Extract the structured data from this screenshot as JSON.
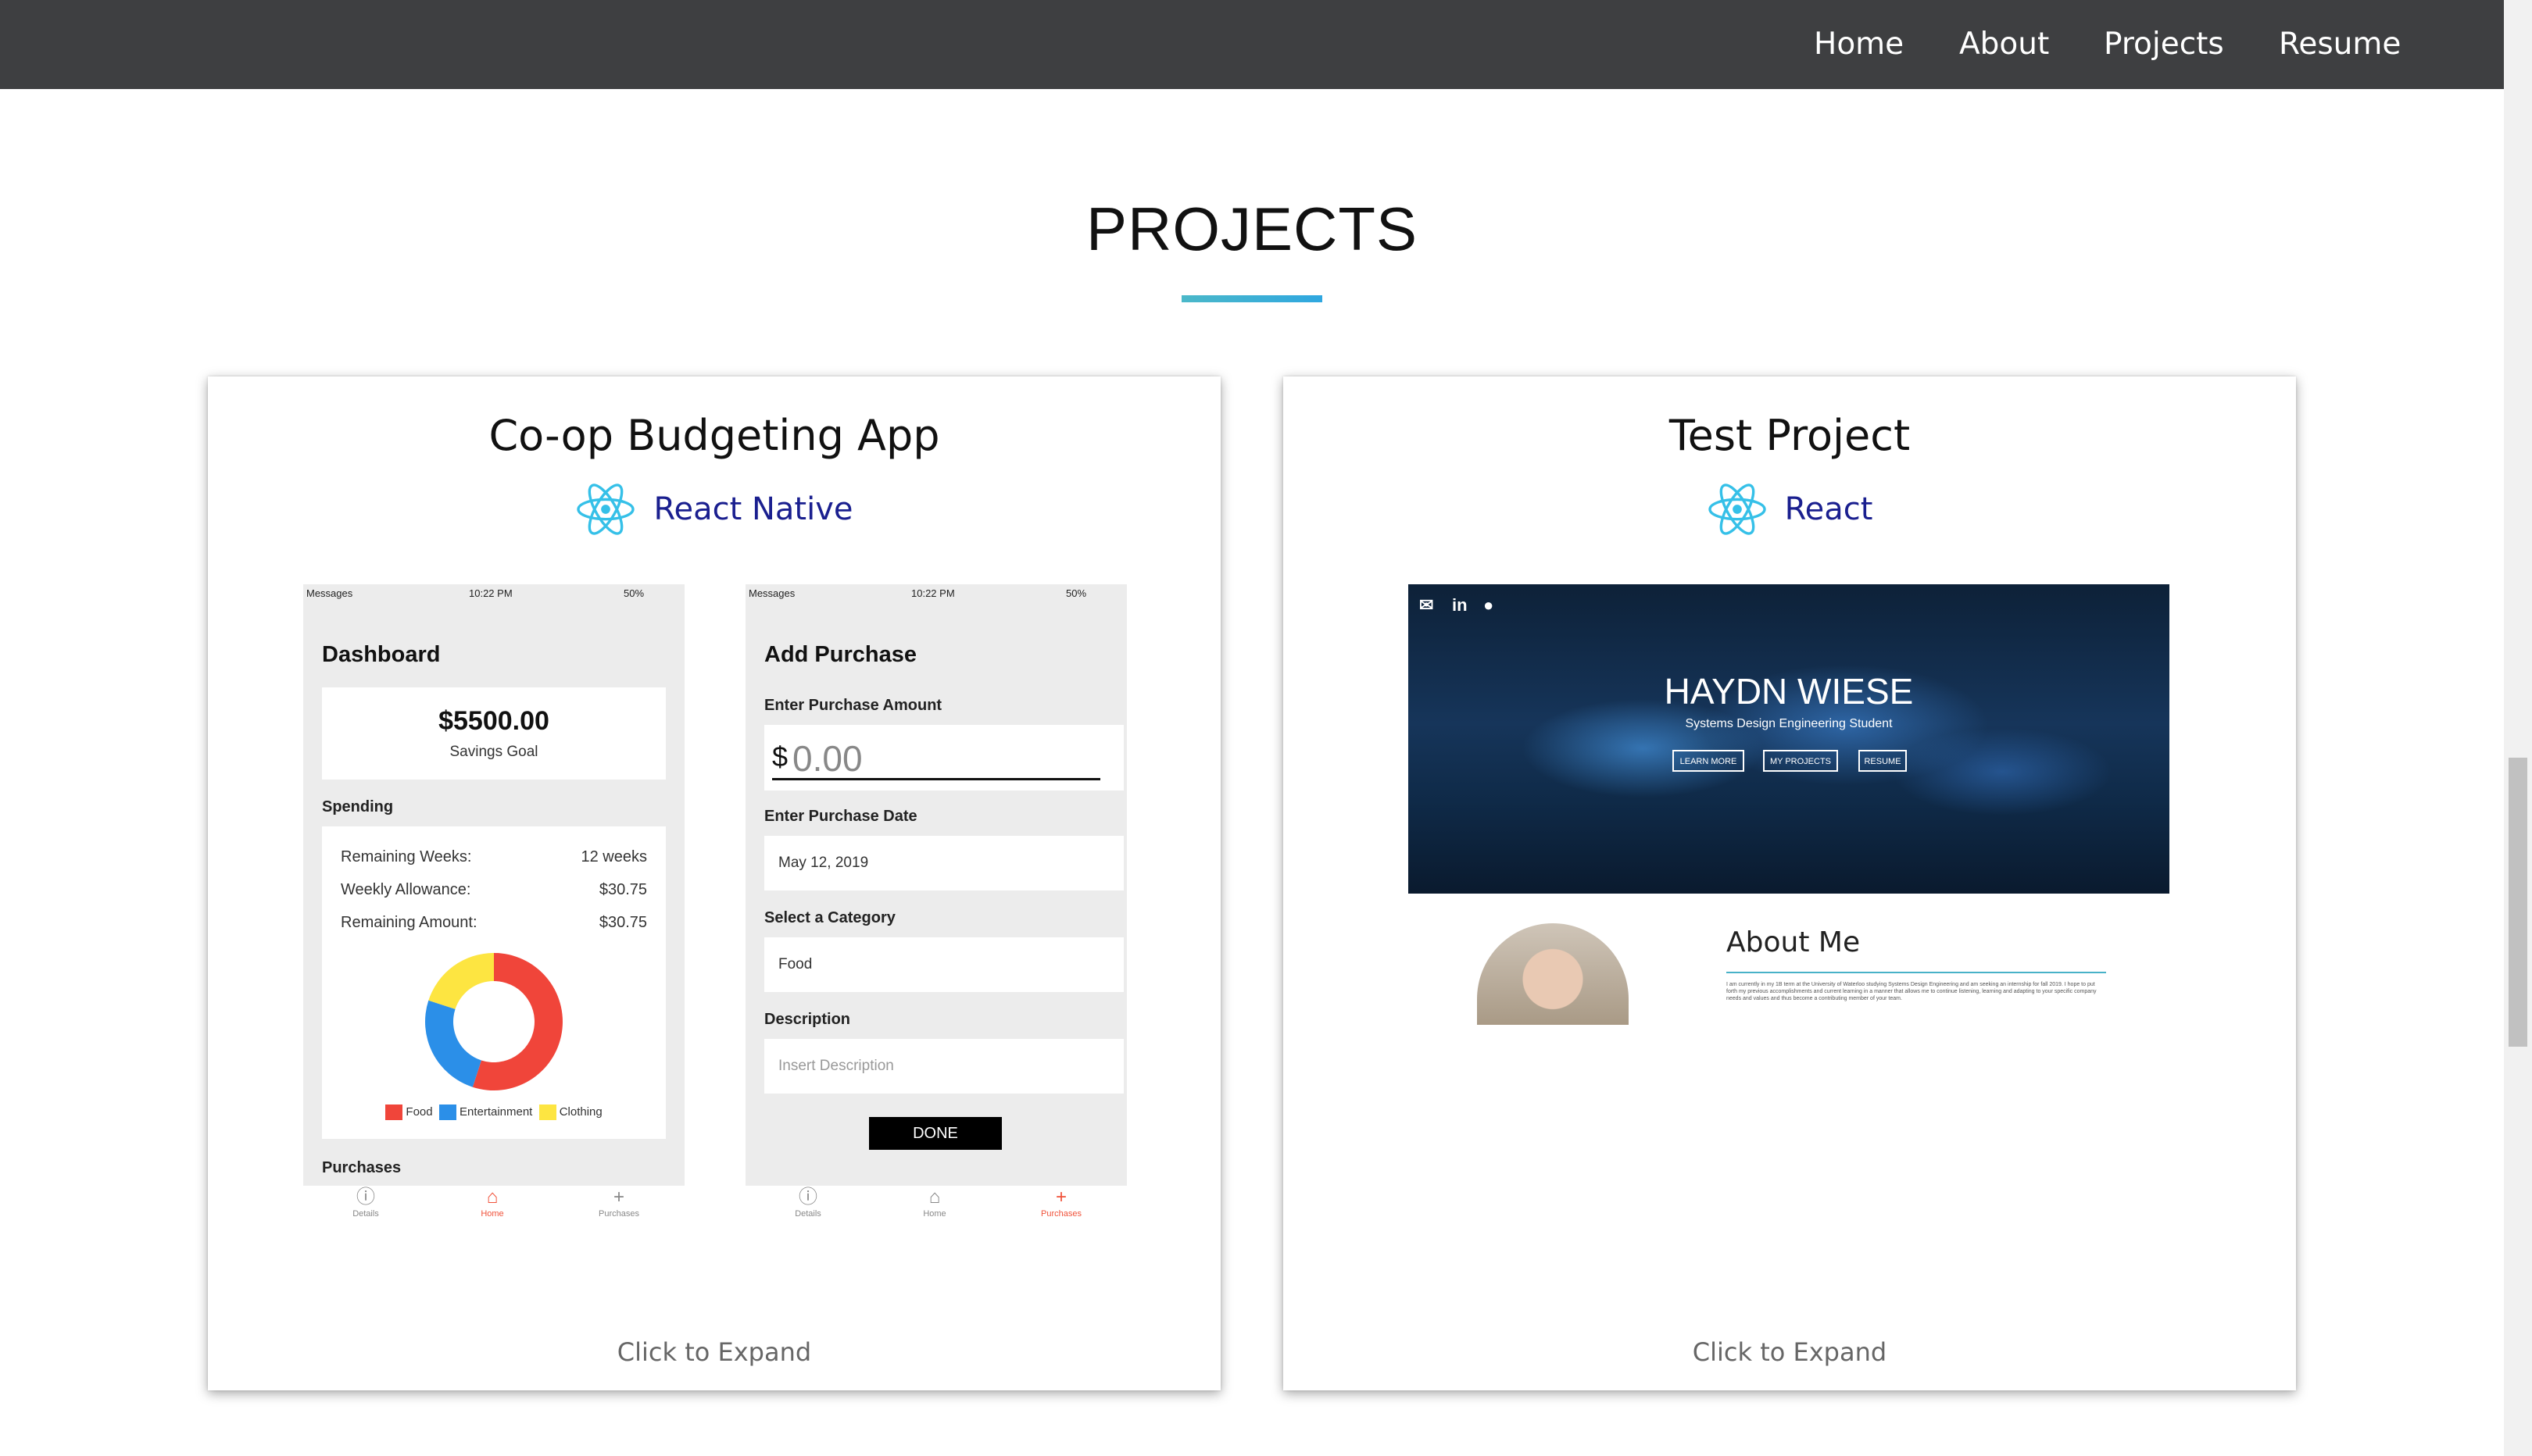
{
  "nav": {
    "links": [
      "Home",
      "About",
      "Projects",
      "Resume"
    ]
  },
  "section": {
    "title": "PROJECTS"
  },
  "projects": [
    {
      "title": "Co-op Budgeting App",
      "tech": "React Native",
      "expand": "Click to Expand"
    },
    {
      "title": "Test Project",
      "tech": "React",
      "expand": "Click to Expand"
    }
  ],
  "screen1": {
    "status": {
      "carrier": "Messages",
      "time": "10:22 PM",
      "battery": "50%"
    },
    "title": "Dashboard",
    "goal_amount": "$5500.00",
    "goal_label": "Savings Goal",
    "spending_label": "Spending",
    "rows": [
      {
        "label": "Remaining Weeks:",
        "value": "12 weeks"
      },
      {
        "label": "Weekly Allowance:",
        "value": "$30.75"
      },
      {
        "label": "Remaining Amount:",
        "value": "$30.75"
      }
    ],
    "legend": [
      "Food",
      "Entertainment",
      "Clothing"
    ],
    "purchases_label": "Purchases",
    "tabs": [
      "Details",
      "Home",
      "Purchases"
    ]
  },
  "screen2": {
    "status": {
      "carrier": "Messages",
      "time": "10:22 PM",
      "battery": "50%"
    },
    "title": "Add Purchase",
    "amount_label": "Enter Purchase Amount",
    "amount_prefix": "$",
    "amount_placeholder": "0.00",
    "date_label": "Enter Purchase Date",
    "date_value": "May 12, 2019",
    "category_label": "Select a Category",
    "category_value": "Food",
    "desc_label": "Description",
    "desc_placeholder": "Insert Description",
    "done": "DONE",
    "tabs": [
      "Details",
      "Home",
      "Purchases"
    ]
  },
  "preview": {
    "name": "HAYDN WIESE",
    "subtitle": "Systems Design Engineering Student",
    "buttons": [
      "LEARN MORE",
      "MY PROJECTS",
      "RESUME"
    ],
    "about_title": "About Me",
    "about_text": "I am currently in my 1B term at the University of Waterloo studying Systems Design Engineering and am seeking an internship for fall 2019. I hope to put forth my previous accomplishments and current learning in a manner that allows me to continue listening, learning and adapting to your specific company needs and values and thus become a contributing member of your team."
  },
  "colors": {
    "nav_bg": "#3e3f41",
    "accent": "#2fa7e0",
    "react": "#35c0e8",
    "tech_text": "#1a1f8f",
    "donut_food": "#f0453a",
    "donut_entertainment": "#2b8fe8",
    "donut_clothing": "#fde541"
  },
  "donut": {
    "food": 0.55,
    "entertainment": 0.25,
    "clothing": 0.2
  }
}
